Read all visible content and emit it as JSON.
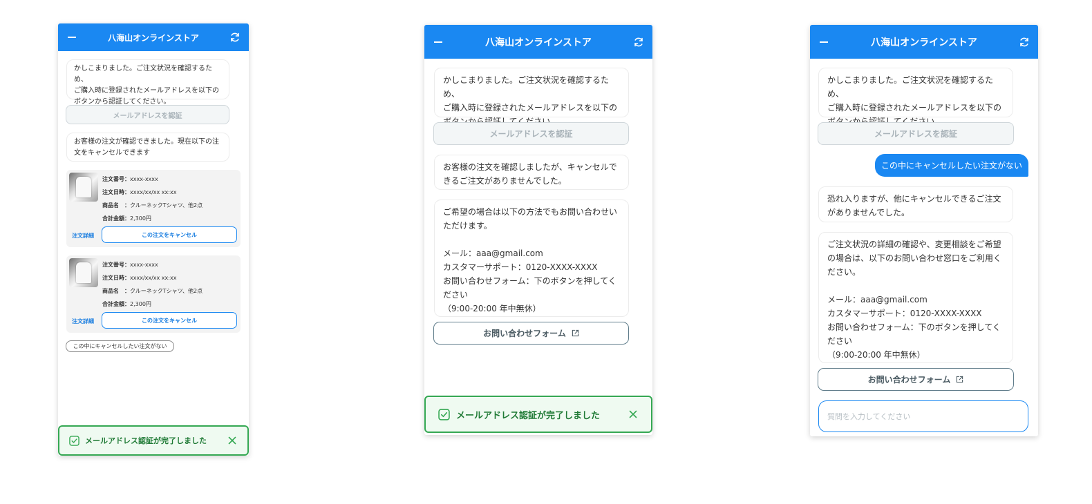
{
  "app": {
    "title": "八海山オンラインストア"
  },
  "messages": {
    "verify_prompt": "かしこまりました。ご注文状況を確認するため、\nご購入時に登録されたメールアドレスを以下のボタンから認証してください。",
    "orders_found": "お客様の注文が確認できました。現在以下の注文をキャンセルできます",
    "no_cancelable": "お客様の注文を確認しましたが、キャンセルできるご注文がありませんでした。",
    "contact_info": "ご希望の場合は以下の方法でもお問い合わせいただけます。\n\nメール：aaa@gmail.com\nカスタマーサポート：0120-XXXX-XXXX\nお問い合わせフォーム：下のボタンを押してください\n（9:00-20:00 年中無休）",
    "user_reply": "この中にキャンセルしたい注文がない",
    "sorry_none": "恐れ入りますが、他にキャンセルできるご注文がありませんでした。",
    "contact_detail": "ご注文状況の詳細の確認や、変更相談をご希望の場合は、以下のお問い合わせ窓口をご利用ください。\n\nメール：aaa@gmail.com\nカスタマーサポート：0120-XXXX-XXXX\nお問い合わせフォーム：下のボタンを押してください\n（9:00-20:00 年中無休）"
  },
  "buttons": {
    "verify_email": "メールアドレスを認証",
    "no_cancel_option": "この中にキャンセルしたい注文がない",
    "contact_form": "お問い合わせフォーム",
    "order_detail": "注文詳細",
    "cancel_order": "この注文をキャンセル"
  },
  "orders": [
    {
      "order_no_label": "注文番号：",
      "order_no": "xxxx-xxxx",
      "date_label": "注文日時：",
      "date": "xxxx/xx/xx xx:xx",
      "product_label": "商品名　：",
      "product": "クルーネックTシャツ、他2点",
      "total_label": "合計金額：",
      "total": "2,300円"
    },
    {
      "order_no_label": "注文番号：",
      "order_no": "xxxx-xxxx",
      "date_label": "注文日時：",
      "date": "xxxx/xx/xx xx:xx",
      "product_label": "商品名　：",
      "product": "クルーネックTシャツ、他2点",
      "total_label": "合計金額：",
      "total": "2,300円"
    }
  ],
  "toast": {
    "message": "メールアドレス認証が完了しました"
  },
  "input": {
    "placeholder": "質問を入力してください"
  },
  "colors": {
    "accent": "#1a88f2",
    "success": "#35a853",
    "success_bg": "#effaf1"
  },
  "icons": [
    "minimize-icon",
    "refresh-icon",
    "check-icon",
    "close-icon",
    "external-link-icon"
  ]
}
